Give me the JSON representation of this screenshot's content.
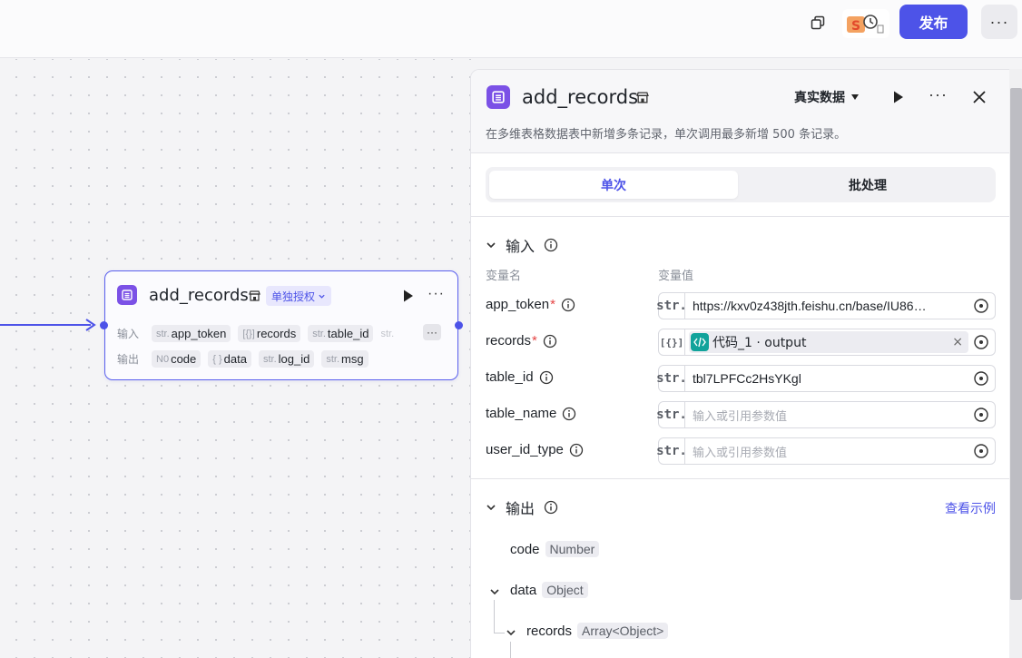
{
  "topbar": {
    "copy_icon": "copy-icon",
    "history_icon": "history-icon",
    "publish_label": "发布",
    "more_icon": "more-icon"
  },
  "node": {
    "title": "add_records",
    "store_icon": "store-icon",
    "auth_label": "单独授权",
    "input_label": "输入",
    "output_label": "输出",
    "inputs": [
      {
        "type": "str.",
        "name": "app_token"
      },
      {
        "type": "[{}]",
        "name": "records"
      },
      {
        "type": "str.",
        "name": "table_id"
      },
      {
        "type": "str.",
        "name": "tab"
      }
    ],
    "outputs": [
      {
        "type": "N0",
        "name": "code"
      },
      {
        "type": "{ }",
        "name": "data"
      },
      {
        "type": "str.",
        "name": "log_id"
      },
      {
        "type": "str.",
        "name": "msg"
      }
    ]
  },
  "panel": {
    "title": "add_records",
    "mode_label": "真实数据",
    "description": "在多维表格数据表中新增多条记录，单次调用最多新增 500 条记录。",
    "tabs": [
      {
        "label": "单次",
        "active": true
      },
      {
        "label": "批处理",
        "active": false
      }
    ],
    "input_section": {
      "title": "输入",
      "col_name": "变量名",
      "col_value": "变量值",
      "fields": [
        {
          "name": "app_token",
          "required": true,
          "type": "str.",
          "value": "https://kxv0z438jth.feishu.cn/base/IU86…",
          "placeholder": ""
        },
        {
          "name": "records",
          "required": true,
          "type": "[{}]",
          "ref": "代码_1 · output"
        },
        {
          "name": "table_id",
          "required": false,
          "type": "str.",
          "value": "tbl7LPFCc2HsYKgl",
          "placeholder": ""
        },
        {
          "name": "table_name",
          "required": false,
          "type": "str.",
          "value": "",
          "placeholder": "输入或引用参数值"
        },
        {
          "name": "user_id_type",
          "required": false,
          "type": "str.",
          "value": "",
          "placeholder": "输入或引用参数值"
        }
      ]
    },
    "output_section": {
      "title": "输出",
      "example_link": "查看示例",
      "items": [
        {
          "name": "code",
          "type": "Number"
        },
        {
          "name": "data",
          "type": "Object"
        },
        {
          "name": "records",
          "type": "Array<Object>"
        }
      ]
    }
  },
  "colors": {
    "accent": "#4d53e8",
    "node_icon": "#7b51e6",
    "code_icon": "#11a39b",
    "required": "#e54545"
  }
}
